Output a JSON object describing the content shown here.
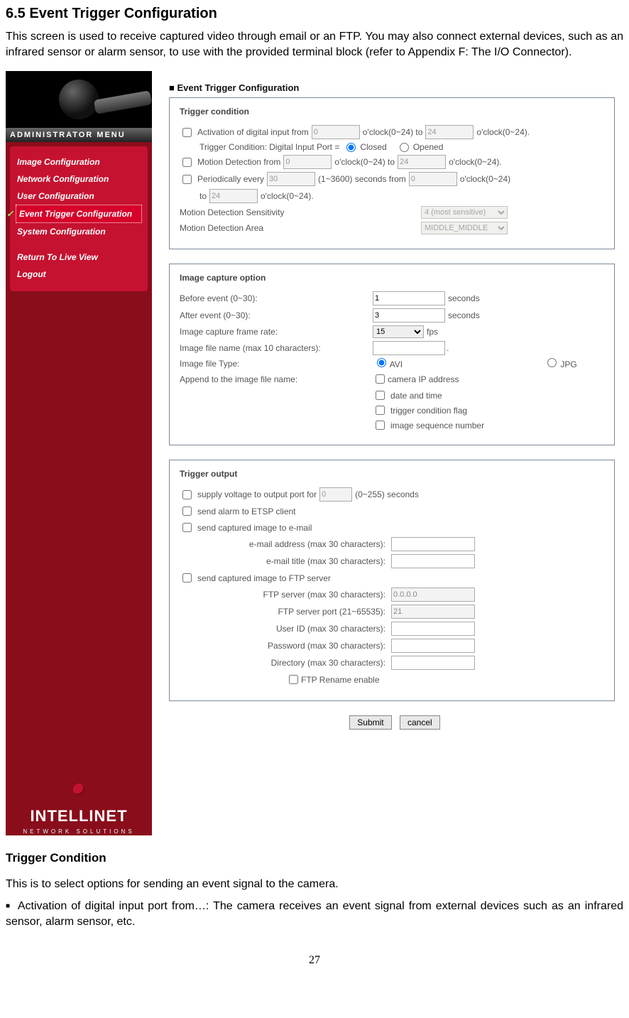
{
  "headings": {
    "main": "6.5 Event Trigger Configuration",
    "sub": "Trigger Condition"
  },
  "intro": "This screen is used to receive captured video through email or an FTP. You may also connect external devices, such as an infrared sensor or alarm sensor, to use with the provided terminal block (refer to Appendix F: The I/O Connector).",
  "sidebar": {
    "adminLabel": "ADMINISTRATOR MENU",
    "items": [
      "Image Configuration",
      "Network Configuration",
      "User Configuration",
      "Event Trigger Configuration",
      "System Configuration",
      "Return To Live View",
      "Logout"
    ],
    "logoWord": "INTELLINET",
    "logoSub": "NETWORK SOLUTIONS"
  },
  "panel": {
    "title": "Event Trigger Configuration"
  },
  "trigger_cond": {
    "head": "Trigger condition",
    "act_from": "Activation of digital input from",
    "oclock_to": "o'clock(0~24) to",
    "oclock_end": "o'clock(0~24).",
    "cond_line": "Trigger Condition: Digital Input Port =",
    "closed": "Closed",
    "opened": "Opened",
    "motion_from": "Motion Detection from",
    "periodically": "Periodically every",
    "sec_from": "(1~3600) seconds from",
    "oclock024": "o'clock(0~24)",
    "to": "to",
    "sens": "Motion Detection Sensitivity",
    "area": "Motion Detection Area",
    "val0a": "0",
    "val24a": "24",
    "val0b": "0",
    "val24b": "24",
    "val30": "30",
    "val0c": "0",
    "val24c": "24",
    "sens_opt": "4 (most sensitive)",
    "area_opt": "MIDDLE_MIDDLE"
  },
  "capture": {
    "head": "Image capture option",
    "before": "Before event (0~30):",
    "after": "After event (0~30):",
    "rate": "Image capture frame rate:",
    "fname": "Image file name (max 10 characters):",
    "ftype": "Image file Type:",
    "append": "Append to the image file name:",
    "seconds": "seconds",
    "fps": "fps",
    "avi": "AVI",
    "jpg": "JPG",
    "val_before": "1",
    "val_after": "3",
    "val_fps": "15",
    "app1": "camera IP address",
    "app2": "date and time",
    "app3": "trigger condition flag",
    "app4": "image sequence number"
  },
  "output": {
    "head": "Trigger output",
    "supply": "supply voltage to output port for",
    "supply_end": "(0~255) seconds",
    "etsp": "send alarm to ETSP client",
    "email": "send captured image to e-mail",
    "email_addr": "e-mail address (max 30 characters):",
    "email_title": "e-mail title (max 30 characters):",
    "ftp": "send captured image to FTP server",
    "ftp_server": "FTP server (max 30 characters):",
    "ftp_port": "FTP server port (21~65535):",
    "ftp_user": "User ID (max 30 characters):",
    "ftp_pass": "Password (max 30 characters):",
    "ftp_dir": "Directory (max 30 characters):",
    "ftp_rename": "FTP Rename enable",
    "val0": "0",
    "val_ftp": "0.0.0.0",
    "val_port": "21"
  },
  "buttons": {
    "submit": "Submit",
    "cancel": "cancel"
  },
  "doc_text": {
    "intro2": "This is to select options for sending an event signal to the camera.",
    "bullet1": "Activation of digital input port from…: The camera receives an event signal from external devices such as an infrared sensor, alarm sensor, etc."
  },
  "pagenum": "27"
}
